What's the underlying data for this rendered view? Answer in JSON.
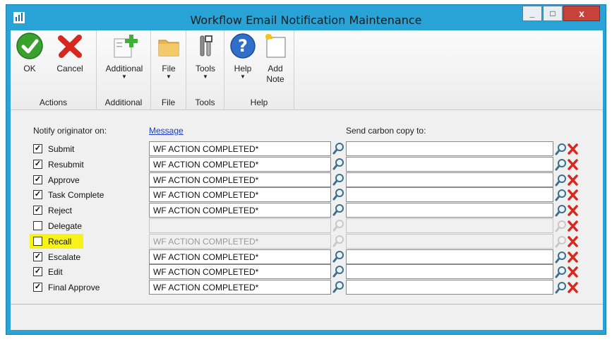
{
  "window": {
    "title": "Workflow Email Notification Maintenance",
    "min_label": "_",
    "max_label": "□",
    "close_label": "x"
  },
  "ribbon": {
    "buttons": {
      "ok": "OK",
      "cancel": "Cancel",
      "additional": "Additional",
      "file": "File",
      "tools": "Tools",
      "help": "Help",
      "add_note_1": "Add",
      "add_note_2": "Note"
    },
    "groups": {
      "actions": "Actions",
      "additional": "Additional",
      "file": "File",
      "tools": "Tools",
      "help": "Help"
    }
  },
  "headers": {
    "notify": "Notify originator on:",
    "message": "Message",
    "cc": "Send carbon copy to:"
  },
  "rows": [
    {
      "label": "Submit",
      "checked": true,
      "message": "WF ACTION COMPLETED*",
      "enabled": true
    },
    {
      "label": "Resubmit",
      "checked": true,
      "message": "WF ACTION COMPLETED*",
      "enabled": true
    },
    {
      "label": "Approve",
      "checked": true,
      "message": "WF ACTION COMPLETED*",
      "enabled": true
    },
    {
      "label": "Task Complete",
      "checked": true,
      "message": "WF ACTION COMPLETED*",
      "enabled": true
    },
    {
      "label": "Reject",
      "checked": true,
      "message": "WF ACTION COMPLETED*",
      "enabled": true
    },
    {
      "label": "Delegate",
      "checked": false,
      "message": "",
      "enabled": false
    },
    {
      "label": "Recall",
      "checked": false,
      "message": "WF ACTION COMPLETED*",
      "enabled": false,
      "highlighted": true
    },
    {
      "label": "Escalate",
      "checked": true,
      "message": "WF ACTION COMPLETED*",
      "enabled": true
    },
    {
      "label": "Edit",
      "checked": true,
      "message": "WF ACTION COMPLETED*",
      "enabled": true
    },
    {
      "label": "Final Approve",
      "checked": true,
      "message": "WF ACTION COMPLETED*",
      "enabled": true
    }
  ],
  "colors": {
    "titlebar": "#29a3d6",
    "highlight": "#f6f21a",
    "delete_red": "#d8271c",
    "ok_green": "#3aa02e"
  }
}
